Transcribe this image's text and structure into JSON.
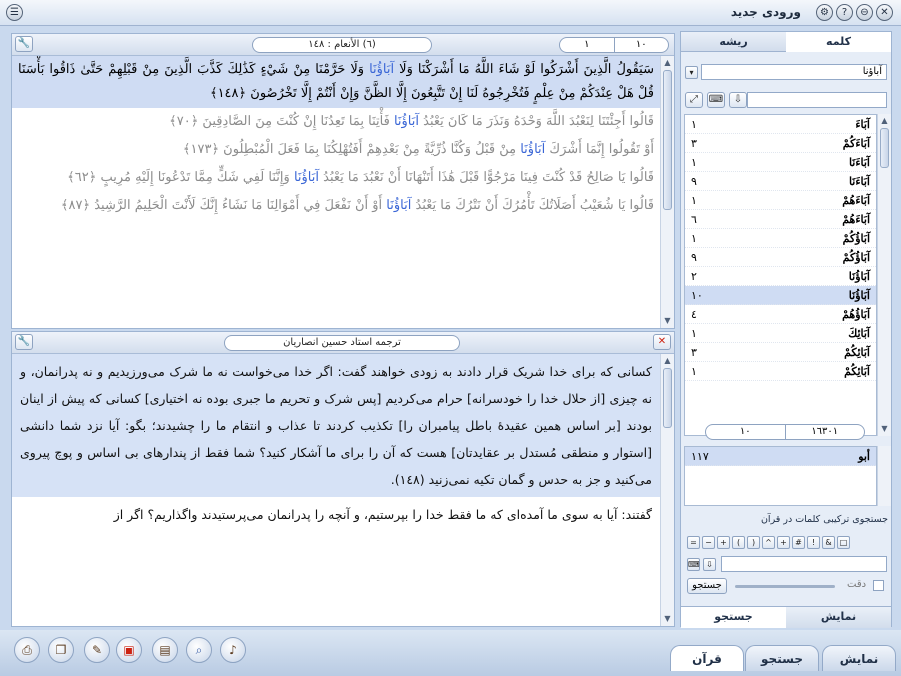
{
  "window": {
    "title": "ورودی جدید",
    "buttons": {
      "close": "✕",
      "minimize": "⊖",
      "help": "?",
      "settings": "⚙"
    }
  },
  "verse_panel": {
    "header": {
      "surah": "(٦) الأنعام : ١٤٨",
      "count": "١٠",
      "current": "١"
    },
    "verses": [
      {
        "pre": "سَيَقُولُ الَّذِينَ أَشْرَكُوا لَوْ شَاءَ اللَّهُ مَا أَشْرَكْنَا وَلَا ",
        "hl": "آبَاؤُنَا",
        "post": " وَلَا حَرَّمْنَا مِنْ شَيْءٍ كَذَٰلِكَ كَذَّبَ الَّذِينَ مِنْ قَبْلِهِمْ حَتَّىٰ ذَاقُوا بَأْسَنَا قُلْ هَلْ عِنْدَكُمْ مِنْ عِلْمٍ فَتُخْرِجُوهُ لَنَا إِنْ تَتَّبِعُونَ إِلَّا الظَّنَّ وَإِنْ أَنْتُمْ إِلَّا تَخْرُصُونَ ﴿١٤٨﴾"
      },
      {
        "pre": "قَالُوا أَجِئْتَنَا لِنَعْبُدَ اللَّهَ وَحْدَهُ وَنَذَرَ مَا كَانَ يَعْبُدُ ",
        "hl": "آبَاؤُنَا",
        "post": " فَأْتِنَا بِمَا تَعِدُنَا إِنْ كُنْتَ مِنَ الصَّادِقِينَ ﴿٧٠﴾"
      },
      {
        "pre": "أَوْ تَقُولُوا إِنَّمَا أَشْرَكَ ",
        "hl": "آبَاؤُنَا",
        "post": " مِنْ قَبْلُ وَكُنَّا ذُرِّيَّةً مِنْ بَعْدِهِمْ أَفَتُهْلِكُنَا بِمَا فَعَلَ الْمُبْطِلُونَ ﴿١٧٣﴾"
      },
      {
        "pre": "قَالُوا يَا صَالِحُ قَدْ كُنْتَ فِينَا مَرْجُوًّا قَبْلَ هَٰذَا أَتَنْهَانَا أَنْ نَعْبُدَ مَا يَعْبُدُ ",
        "hl": "آبَاؤُنَا",
        "post": " وَإِنَّنَا لَفِي شَكٍّ مِمَّا تَدْعُونَا إِلَيْهِ مُرِيبٍ ﴿٦٢﴾"
      },
      {
        "pre": "قَالُوا يَا شُعَيْبُ أَصَلَاتُكَ تَأْمُرُكَ أَنْ نَتْرُكَ مَا يَعْبُدُ ",
        "hl": "آبَاؤُنَا",
        "post": " أَوْ أَنْ نَفْعَلَ فِي أَمْوَالِنَا مَا نَشَاءُ إِنَّكَ لَأَنْتَ الْحَلِيمُ الرَّشِيدُ ﴿٨٧﴾"
      }
    ]
  },
  "translation_panel": {
    "title": "ترجمه استاد حسین انصاریان",
    "paragraphs": [
      "کسانی که برای خدا شریک قرار دادند به زودی خواهند گفت: اگر خدا می‌خواست نه ما شرک می‌ورزیدیم و نه پدرانمان، و نه چیزی [از حلال خدا را خودسرانه] حرام می‌کردیم [پس شرک و تحریم ما جبری بوده نه اختیاری] کسانی که پیش از اینان بودند [بر اساس همین عقیدهٔ باطل پیامبران را] تکذیب کردند تا عذاب و انتقام ما را چشیدند؛ بگو: آیا نزد شما دانشی [استوار و منطقی مُستدل بر عقایدتان] هست که آن را برای ما آشکار کنید؟ شما فقط از پندارهای بی اساس و پوچ پیروی می‌کنید و جز به حدس و گمان تکیه نمی‌زنید (١٤٨).",
      "گفتند: آیا به سوی ما آمده‌ای که ما فقط خدا را بپرستیم، و آنچه را پدرانمان می‌پرستیدند واگذاریم؟ اگر از"
    ]
  },
  "side_panel": {
    "tabs": {
      "word": "کلمه",
      "root": "ریشه"
    },
    "search_value": "آباؤنا",
    "words": [
      {
        "w": "آبَاءَ",
        "c": "١"
      },
      {
        "w": "آبَاءَكُمْ",
        "c": "٣"
      },
      {
        "w": "آبَاءَنَا",
        "c": "١"
      },
      {
        "w": "آبَاءَنَا",
        "c": "٩"
      },
      {
        "w": "آبَاءَهُمْ",
        "c": "١"
      },
      {
        "w": "آبَاءَهُمْ",
        "c": "٦"
      },
      {
        "w": "آبَاؤُكُمْ",
        "c": "١"
      },
      {
        "w": "آبَاؤُكُمْ",
        "c": "٩"
      },
      {
        "w": "آبَاؤُنَا",
        "c": "٢"
      },
      {
        "w": "آبَاؤُنَا",
        "c": "١٠"
      },
      {
        "w": "آبَاؤُهُمْ",
        "c": "٤"
      },
      {
        "w": "آبَائِكَ",
        "c": "١"
      },
      {
        "w": "آبَائِكُمْ",
        "c": "٣"
      },
      {
        "w": "آبَائِكُمْ",
        "c": "١"
      }
    ],
    "selected_index": 9,
    "counter": {
      "left": "١٠",
      "right": "١٦٣٠١"
    },
    "roots": [
      {
        "w": "أبو",
        "c": "١١٧"
      }
    ],
    "combo_title": "جستجوی ترکیبی کلمات در قرآن",
    "ops": [
      "=",
      "−",
      "+",
      "(",
      ")",
      "^",
      "+",
      "#",
      "!",
      "&",
      "□"
    ],
    "exact_label": "دقت",
    "search_btn": "جستجو",
    "bottom_tabs": {
      "display": "نمایش",
      "search": "جستجو"
    }
  },
  "bottom": {
    "tabs": {
      "quran": "قرآن",
      "search": "جستجو",
      "display": "نمایش"
    }
  },
  "icons": {
    "tool": "🔧",
    "down": "▼",
    "up": "▲",
    "close": "✕"
  }
}
